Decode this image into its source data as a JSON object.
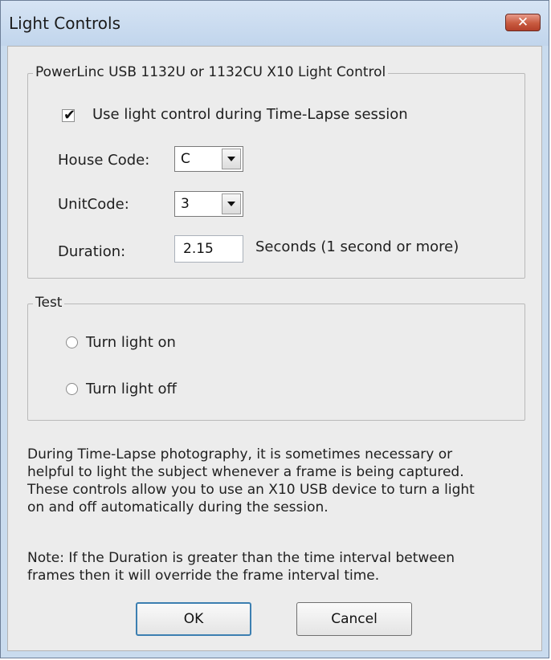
{
  "window": {
    "title": "Light Controls",
    "close_glyph": "✕"
  },
  "group_x10": {
    "legend": "PowerLinc USB 1132U or 1132CU X10 Light Control",
    "use_light_checkbox": {
      "label": "Use light control during Time-Lapse session",
      "checked": true,
      "mark": "✔"
    },
    "house_code": {
      "label": "House Code:",
      "value": "C"
    },
    "unit_code": {
      "label": "UnitCode:",
      "value": "3"
    },
    "duration": {
      "label": "Duration:",
      "value": "2.15",
      "hint": "Seconds (1 second or more)"
    }
  },
  "group_test": {
    "legend": "Test",
    "options": [
      {
        "label": "Turn light on",
        "selected": false
      },
      {
        "label": "Turn light off",
        "selected": false
      }
    ]
  },
  "description": "During Time-Lapse photography,  it is sometimes necessary or\nhelpful to light the subject whenever a frame is being captured.\nThese controls allow you to use an X10 USB device to turn a light\non and off automatically during the session.",
  "note": "Note:  If the Duration is greater than the time interval between\nframes then it will override the frame interval time.",
  "buttons": {
    "ok": "OK",
    "cancel": "Cancel"
  },
  "colors": {
    "title_bar": "#c9dbee",
    "close_button": "#c85a3f",
    "dialog_background": "#ececec",
    "default_button_border": "#3c7fb1"
  },
  "icons": {
    "close": "close-icon",
    "dropdown": "chevron-down-icon",
    "check": "checkmark-icon"
  }
}
